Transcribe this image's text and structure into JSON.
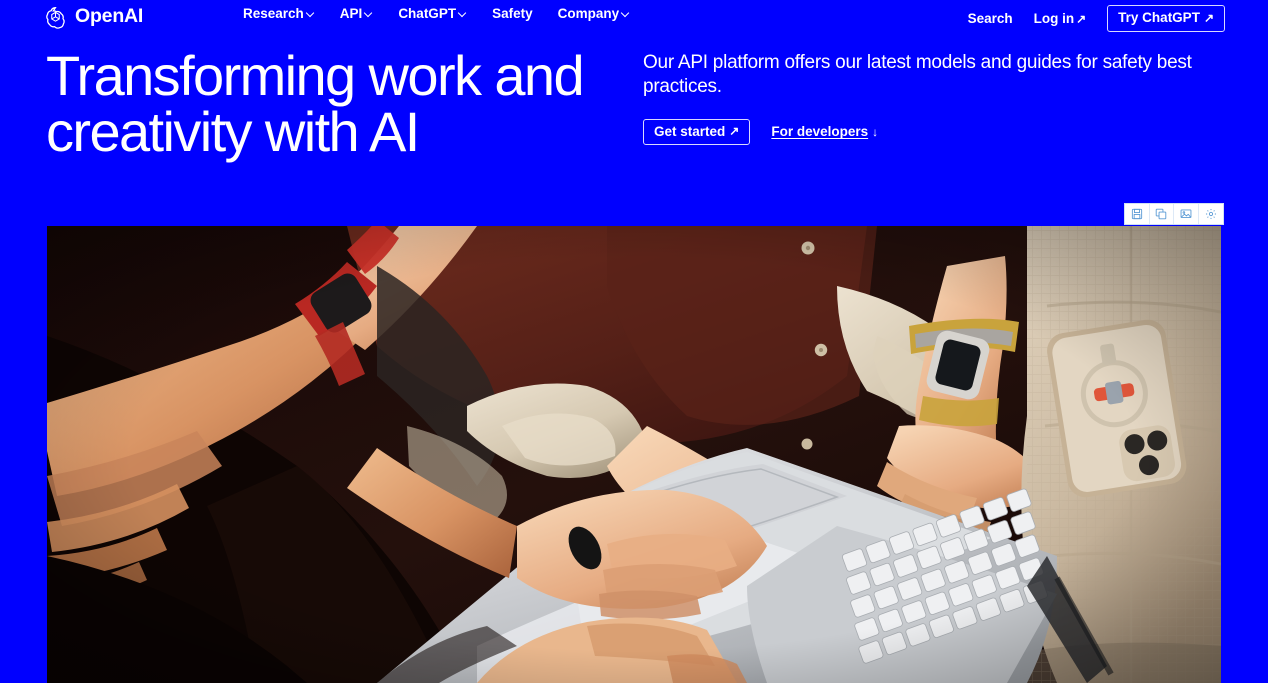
{
  "theme": {
    "background": "#0000FF",
    "foreground": "#FFFFFF",
    "toolbar_bg": "#FFFFFF",
    "toolbar_icon": "#5B9BD5"
  },
  "header": {
    "brand": {
      "name": "OpenAI",
      "logo_icon": "openai-logo-icon"
    },
    "nav": [
      {
        "label": "Research",
        "has_dropdown": true,
        "icon": "chevron-down-icon"
      },
      {
        "label": "API",
        "has_dropdown": true,
        "icon": "chevron-down-icon"
      },
      {
        "label": "ChatGPT",
        "has_dropdown": true,
        "icon": "chevron-down-icon"
      },
      {
        "label": "Safety",
        "has_dropdown": false,
        "icon": ""
      },
      {
        "label": "Company",
        "has_dropdown": true,
        "icon": "chevron-down-icon"
      }
    ],
    "actions": {
      "search_label": "Search",
      "login_label": "Log in",
      "login_arrow": "↗",
      "cta_label": "Try ChatGPT",
      "cta_arrow": "↗"
    }
  },
  "hero": {
    "title": "Transforming work and\ncreativity with AI",
    "description": "Our API platform offers our latest models and guides for safety best practices.",
    "primary_cta": {
      "label": "Get started",
      "arrow": "↗"
    },
    "secondary_cta": {
      "label": "For developers",
      "arrow": "↓"
    }
  },
  "image_toolbar": {
    "buttons": [
      {
        "name": "save-icon",
        "title": "Save"
      },
      {
        "name": "copy-icon",
        "title": "Copy"
      },
      {
        "name": "image-icon",
        "title": "Image"
      },
      {
        "name": "settings-icon",
        "title": "Settings"
      }
    ]
  },
  "hero_image": {
    "alt": "Two people sitting close together on a couch, one typing on a silver laptop keyboard, smartwatches on their wrists, a beige-cased smartphone resting on a knitted cushion at right",
    "palette": {
      "dark_background": "#180806",
      "maroon_shirt": "#5E2218",
      "skin_warm": "#D79A6C",
      "skin_light": "#E8BE9A",
      "cream_fabric": "#D8CBB6",
      "laptop_silver": "#CFD0D2",
      "keyboard_key": "#E6E7E9",
      "cushion_beige": "#CDBCA6",
      "watch_red": "#C02520",
      "watch_yellow": "#C8A33C",
      "phone_case": "#D6C3A8"
    }
  }
}
